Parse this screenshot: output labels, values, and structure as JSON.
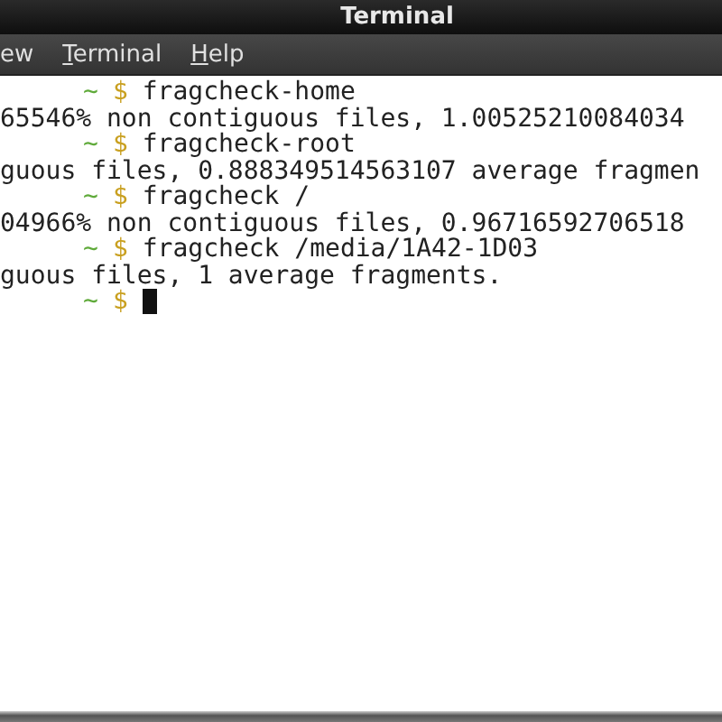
{
  "window": {
    "title": "Terminal"
  },
  "menu": [
    {
      "label": "ew",
      "mnemonic": false
    },
    {
      "label": "Terminal",
      "mnemonic": true
    },
    {
      "label": "Help",
      "mnemonic": true
    }
  ],
  "lines": [
    {
      "kind": "prompt",
      "tilde": "~",
      "sign": "$",
      "command": "fragcheck-home"
    },
    {
      "kind": "output",
      "text": "65546% non contiguous files, 1.00525210084034"
    },
    {
      "kind": "prompt",
      "tilde": "~",
      "sign": "$",
      "command": "fragcheck-root"
    },
    {
      "kind": "output",
      "text": "guous files, 0.888349514563107 average fragmen"
    },
    {
      "kind": "prompt",
      "tilde": "~",
      "sign": "$",
      "command": "fragcheck /"
    },
    {
      "kind": "output",
      "text": "04966% non contiguous files, 0.96716592706518"
    },
    {
      "kind": "prompt",
      "tilde": "~",
      "sign": "$",
      "command": "fragcheck /media/1A42-1D03"
    },
    {
      "kind": "output",
      "text": "guous files, 1 average fragments."
    },
    {
      "kind": "prompt",
      "tilde": "~",
      "sign": "$",
      "cursor": true
    }
  ]
}
